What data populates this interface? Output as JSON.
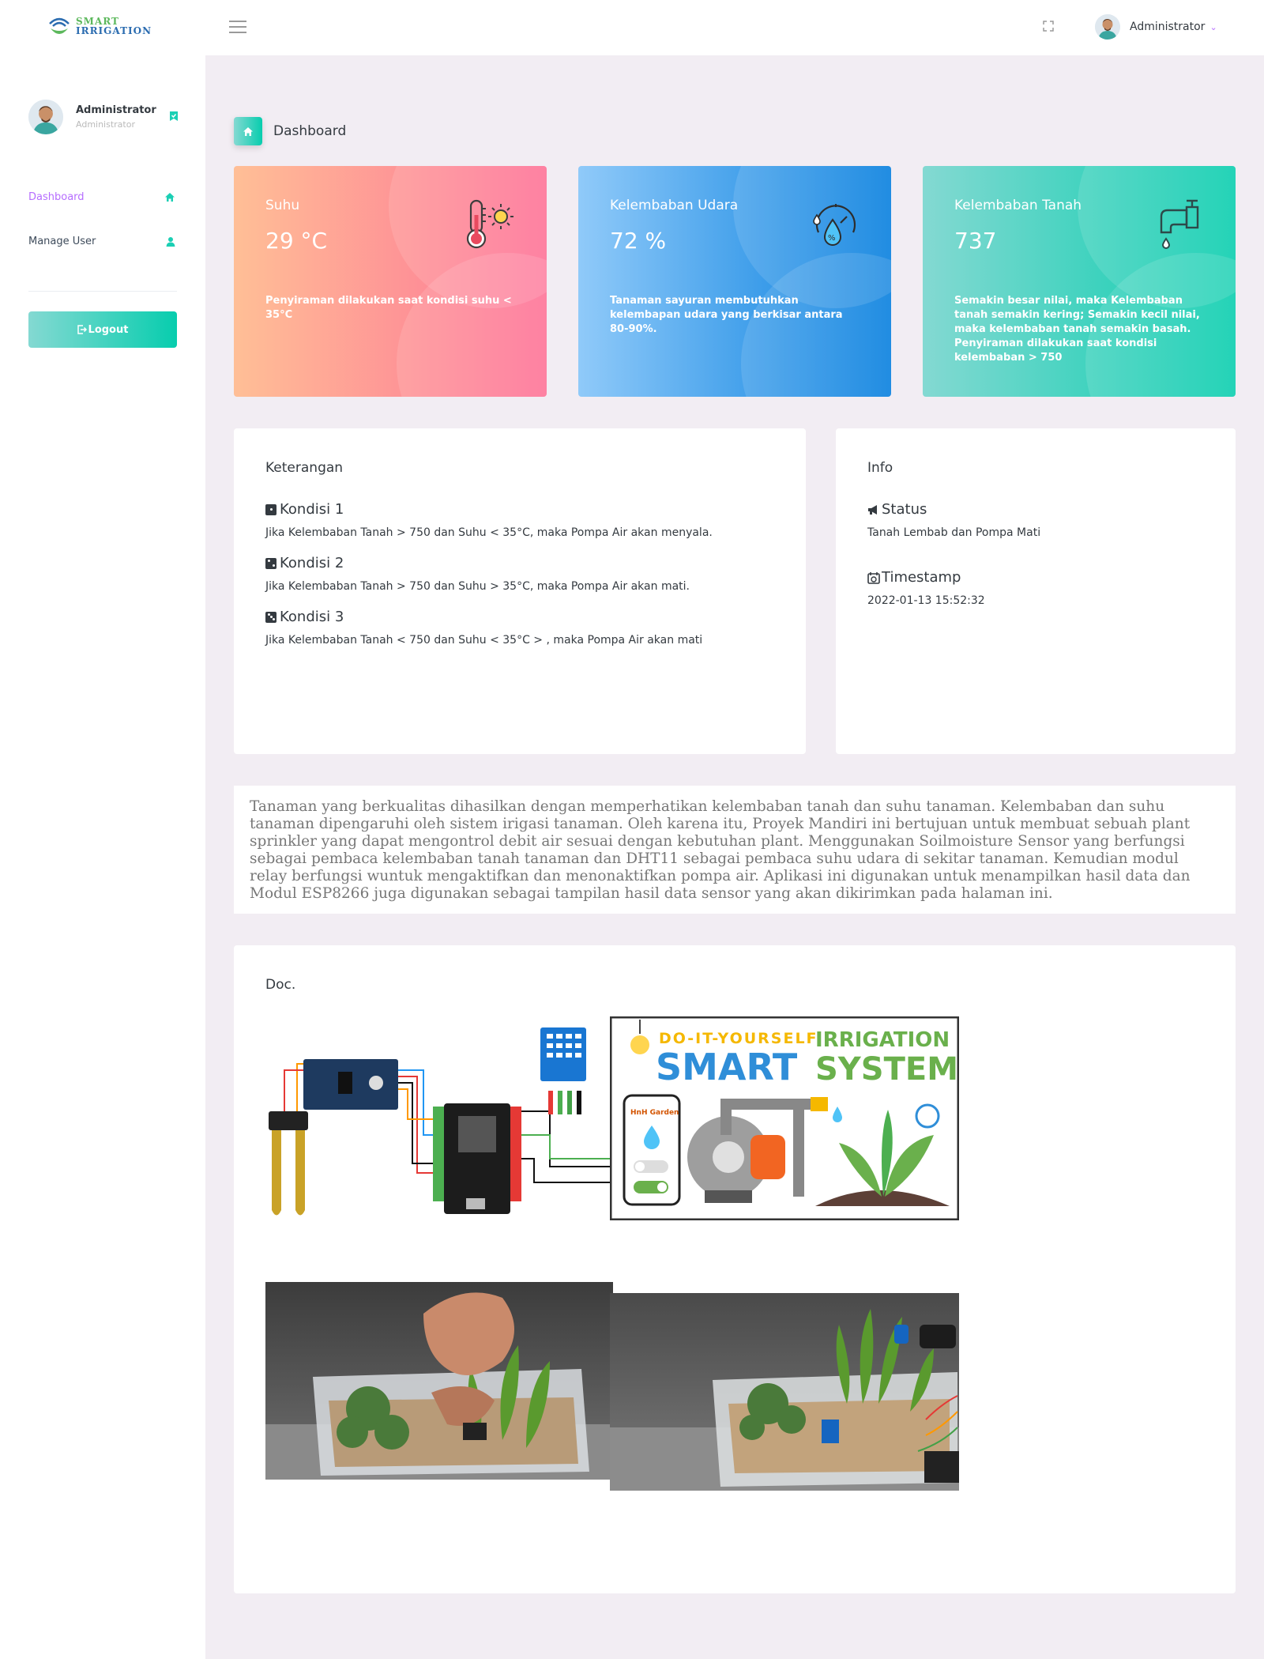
{
  "brand": {
    "line1": "SMART",
    "line2": "IRRIGATION"
  },
  "navbar": {
    "user_name": "Administrator"
  },
  "sidebar": {
    "profile_name": "Administrator",
    "profile_role": "Administrator",
    "items": [
      {
        "label": "Dashboard",
        "icon": "home-icon"
      },
      {
        "label": "Manage User",
        "icon": "user-icon"
      }
    ],
    "logout_label": "Logout"
  },
  "page": {
    "title": "Dashboard"
  },
  "stats": [
    {
      "label": "Suhu",
      "value": "29 °C",
      "note": "Penyiraman dilakukan saat kondisi suhu < 35°C",
      "icon": "thermometer-icon"
    },
    {
      "label": "Kelembaban Udara",
      "value": "72 %",
      "note": "Tanaman sayuran membutuhkan kelembapan udara yang berkisar antara 80-90%.",
      "icon": "humidity-gauge-icon"
    },
    {
      "label": "Kelembaban Tanah",
      "value": "737",
      "note": "Semakin besar nilai, maka Kelembaban tanah semakin kering; Semakin kecil nilai, maka kelembaban tanah semakin basah. Penyiraman dilakukan saat kondisi kelembaban > 750",
      "icon": "water-tap-icon"
    }
  ],
  "keterangan": {
    "title": "Keterangan",
    "conditions": [
      {
        "head": "Kondisi 1",
        "text": "Jika Kelembaban Tanah > 750 dan Suhu < 35°C, maka Pompa Air akan menyala."
      },
      {
        "head": "Kondisi 2",
        "text": "Jika Kelembaban Tanah > 750 dan Suhu > 35°C, maka Pompa Air akan mati."
      },
      {
        "head": "Kondisi 3",
        "text": "Jika Kelembaban Tanah < 750 dan Suhu < 35°C > , maka Pompa Air akan mati"
      }
    ]
  },
  "info": {
    "title": "Info",
    "status_head": "Status",
    "status_text": "Tanah Lembab dan Pompa Mati",
    "timestamp_head": "Timestamp",
    "timestamp_text": "2022-01-13 15:52:32"
  },
  "description": "Tanaman yang berkualitas dihasilkan dengan memperhatikan kelembaban tanah dan suhu tanaman. Kelembaban dan suhu tanaman dipengaruhi oleh sistem irigasi tanaman. Oleh karena itu, Proyek Mandiri ini bertujuan untuk membuat sebuah plant sprinkler yang dapat mengontrol debit air sesuai dengan kebutuhan plant. Menggunakan Soilmoisture Sensor yang berfungsi sebagai pembaca kelembaban tanah tanaman dan DHT11 sebagai pembaca suhu udara di sekitar tanaman. Kemudian modul relay berfungsi wuntuk mengaktifkan dan menonaktifkan pompa air. Aplikasi ini digunakan untuk menampilkan hasil data dan Modul ESP8266 juga digunakan sebagai tampilan hasil data sensor yang akan dikirimkan pada halaman ini.",
  "doc": {
    "title": "Doc.",
    "poster": {
      "line1": "DO-IT-YOURSELF",
      "line2": "IRRIGATION",
      "line3": "SMART",
      "line4": "SYSTEM",
      "app_label": "HnH Garden"
    }
  }
}
